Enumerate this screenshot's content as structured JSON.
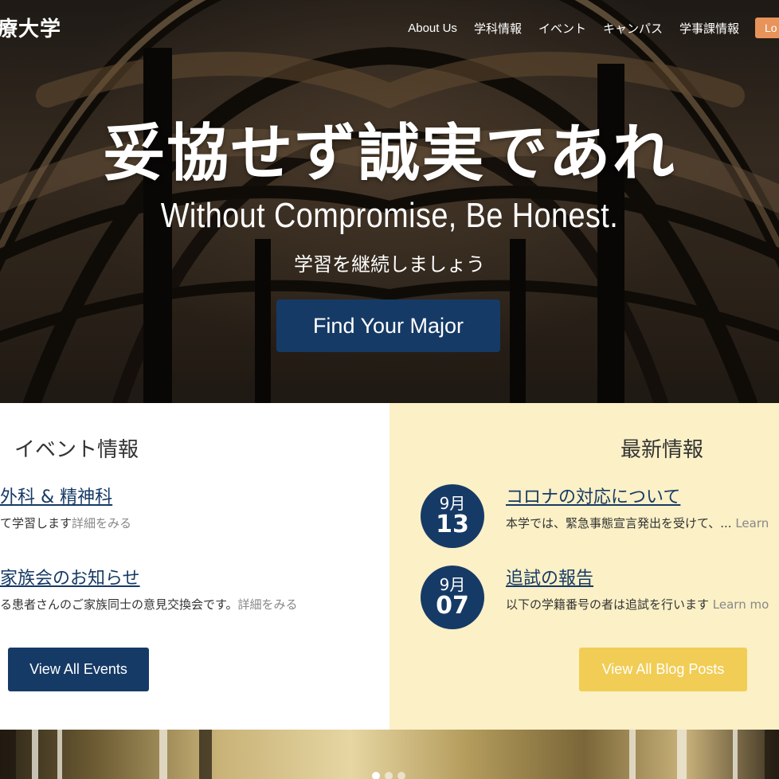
{
  "header": {
    "brand": "療大学",
    "nav": [
      "About Us",
      "学科情報",
      "イベント",
      "キャンパス",
      "学事課情報"
    ],
    "login_label": "Lo"
  },
  "hero": {
    "title": "妥協せず誠実であれ",
    "subtitle": "Without Compromise, Be Honest.",
    "tagline": "学習を継続しましょう",
    "cta_label": "Find Your Major"
  },
  "events": {
    "heading": "イベント情報",
    "items": [
      {
        "title": "外科 & 精神科",
        "desc": "て学習します",
        "more": "詳細をみる"
      },
      {
        "title": "家族会のお知らせ",
        "desc": "る患者さんのご家族同士の意見交換会です。",
        "more": "詳細をみる"
      }
    ],
    "button_label": "View All Events"
  },
  "news": {
    "heading": "最新情報",
    "items": [
      {
        "month": "9月",
        "day": "13",
        "title": "コロナの対応について",
        "desc": "本学では、緊急事態宣言発出を受けて、...",
        "more": "Learn"
      },
      {
        "month": "9月",
        "day": "07",
        "title": "追試の報告",
        "desc": "以下の学籍番号の者は追試を行います",
        "more": "Learn mo"
      }
    ],
    "button_label": "View All Blog Posts"
  },
  "colors": {
    "navy": "#163a66",
    "news_bg": "#fbf0c6",
    "blog_button": "#f1cd55",
    "login": "#e8935a"
  },
  "carousel": {
    "dots": 3,
    "active": 0
  }
}
